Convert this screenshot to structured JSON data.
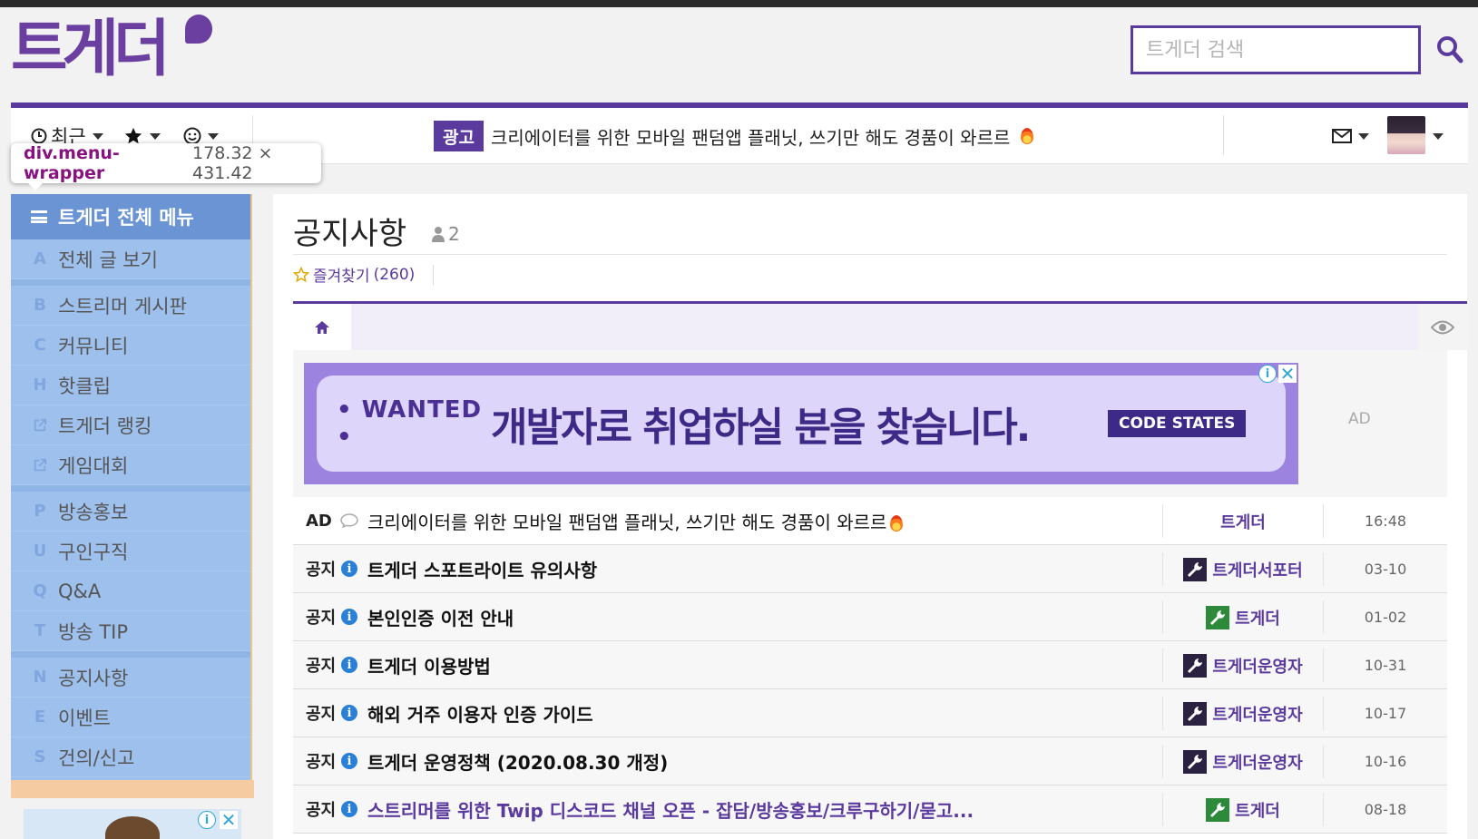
{
  "site": {
    "logo_text": "트게더"
  },
  "search": {
    "placeholder": "트게더 검색"
  },
  "nav": {
    "recent_label": "최근",
    "ad_badge": "광고",
    "ad_text": "크리에이터를 위한 모바일 팬덤앱 플래닛, 쓰기만 해도 경품이 와르르"
  },
  "tooltip": {
    "name": "div.menu-wrapper",
    "size": "178.32 × 431.42"
  },
  "menu": {
    "head": "트게더 전체 메뉴",
    "items": [
      {
        "letter": "A",
        "label": "전체 글 보기"
      },
      {
        "letter": "B",
        "label": "스트리머 게시판"
      },
      {
        "letter": "C",
        "label": "커뮤니티"
      },
      {
        "letter": "H",
        "label": "핫클립"
      },
      {
        "letter": "",
        "label": "트게더 랭킹"
      },
      {
        "letter": "",
        "label": "게임대회"
      },
      {
        "letter": "P",
        "label": "방송홍보"
      },
      {
        "letter": "U",
        "label": "구인구직"
      },
      {
        "letter": "Q",
        "label": "Q&A"
      },
      {
        "letter": "T",
        "label": "방송 TIP"
      },
      {
        "letter": "N",
        "label": "공지사항"
      },
      {
        "letter": "E",
        "label": "이벤트"
      },
      {
        "letter": "S",
        "label": "건의/신고"
      }
    ]
  },
  "board": {
    "title": "공지사항",
    "member_count": "2",
    "favorite_label": "즐겨찾기",
    "favorite_count": "(260)"
  },
  "ad_block": {
    "wanted": "• WANTED •",
    "headline": "개발자로 취업하실 분을 찾습니다.",
    "sponsor": "CODE STATES",
    "label": "AD"
  },
  "posts": [
    {
      "cat": "AD",
      "title": "크리에이터를 위한 모바일 팬덤앱 플래닛, 쓰기만 해도 경품이 와르르",
      "author": "트게더",
      "date": "16:48"
    },
    {
      "cat": "공지",
      "title": "트게더 스포트라이트 유의사항",
      "author": "트게더서포터",
      "date": "03-10"
    },
    {
      "cat": "공지",
      "title": "본인인증 이전 안내",
      "author": "트게더",
      "date": "01-02"
    },
    {
      "cat": "공지",
      "title": "트게더 이용방법",
      "author": "트게더운영자",
      "date": "10-31"
    },
    {
      "cat": "공지",
      "title": "해외 거주 이용자 인증 가이드",
      "author": "트게더운영자",
      "date": "10-17"
    },
    {
      "cat": "공지",
      "title": "트게더 운영정책 (2020.08.30 개정)",
      "author": "트게더운영자",
      "date": "10-16"
    },
    {
      "cat": "공지",
      "title": "스트리머를 위한 Twip 디스코드 채널 오픈 - 잡담/방송홍보/크루구하기/묻고...",
      "author": "트게더",
      "date": "08-18"
    }
  ],
  "colors": {
    "brand": "#5b3a9e",
    "logo": "#6a3fa0",
    "menu_bg": "#9ec0ec",
    "menu_head": "#6a94d4"
  }
}
